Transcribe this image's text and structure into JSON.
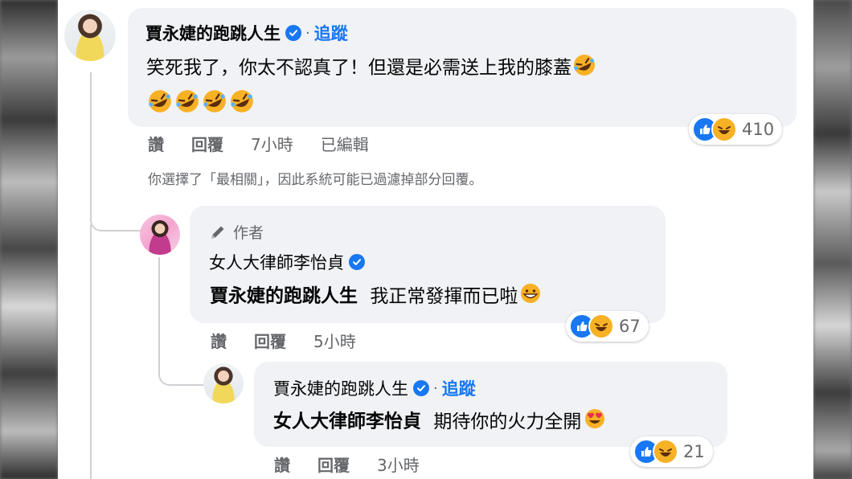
{
  "comment1": {
    "name": "賈永婕的跑跳人生",
    "separator": "·",
    "follow_label": "追蹤",
    "text_line1": "笑死我了，你太不認真了！但還是必需送上我的膝蓋",
    "actions": {
      "like": "讚",
      "reply": "回覆",
      "time": "7小時",
      "edited": "已編輯"
    },
    "reaction_count": "410"
  },
  "filter_note": "你選擇了「最相關」，因此系統可能已過濾掉部分回覆。",
  "reply1": {
    "author_badge": "作者",
    "name": "女人大律師李怡貞",
    "mention": "賈永婕的跑跳人生",
    "text": "我正常發揮而已啦",
    "actions": {
      "like": "讚",
      "reply": "回覆",
      "time": "5小時"
    },
    "reaction_count": "67"
  },
  "reply2": {
    "name": "賈永婕的跑跳人生",
    "separator": "·",
    "follow_label": "追蹤",
    "mention": "女人大律師李怡貞",
    "text": "期待你的火力全開",
    "actions": {
      "like": "讚",
      "reply": "回覆",
      "time": "3小時"
    },
    "reaction_count": "21"
  },
  "icons": {
    "verified": "verified-badge-icon",
    "laugh_cry": "rolling-laughing-emoji",
    "grin": "grinning-sweat-emoji",
    "heart_eyes": "heart-eyes-emoji",
    "like_reaction": "like-reaction-icon",
    "haha_reaction": "haha-reaction-icon",
    "pencil": "pencil-icon"
  },
  "colors": {
    "brand_blue": "#1877f2",
    "bubble": "#f0f2f5",
    "muted_text": "#65676b",
    "reaction_yellow": "#f7b125"
  }
}
